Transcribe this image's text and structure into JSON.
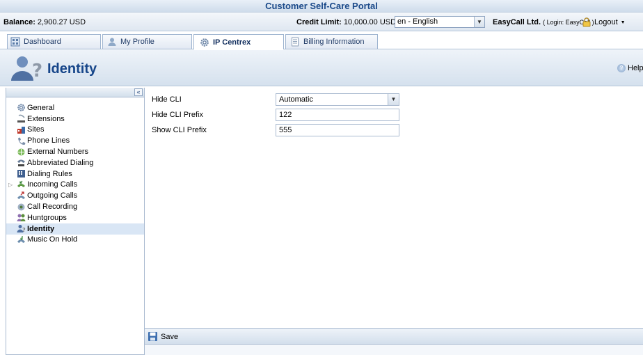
{
  "portal": {
    "title": "Customer Self-Care Portal"
  },
  "info": {
    "balance_label": "Balance:",
    "balance_value": "2,900.27 USD",
    "credit_label": "Credit Limit:",
    "credit_value": "10,000.00 USD",
    "language": "en - English",
    "company_name": "EasyCall Ltd.",
    "login_text": "( Login: EasyCall )",
    "logout_label": "Logout"
  },
  "tabs": [
    {
      "label": "Dashboard",
      "icon": "dashboard-icon"
    },
    {
      "label": "My Profile",
      "icon": "user-icon"
    },
    {
      "label": "IP Centrex",
      "icon": "gear-icon",
      "active": true
    },
    {
      "label": "Billing Information",
      "icon": "document-icon"
    }
  ],
  "header": {
    "title": "Identity",
    "help_label": "Help"
  },
  "sidebar": {
    "items": [
      {
        "label": "General",
        "icon": "gear-icon"
      },
      {
        "label": "Extensions",
        "icon": "extensions-icon"
      },
      {
        "label": "Sites",
        "icon": "sites-icon"
      },
      {
        "label": "Phone Lines",
        "icon": "phone-lines-icon"
      },
      {
        "label": "External Numbers",
        "icon": "external-numbers-icon"
      },
      {
        "label": "Abbreviated Dialing",
        "icon": "abbreviated-dialing-icon"
      },
      {
        "label": "Dialing Rules",
        "icon": "dialing-rules-icon"
      },
      {
        "label": "Incoming Calls",
        "icon": "incoming-calls-icon",
        "expandable": true
      },
      {
        "label": "Outgoing Calls",
        "icon": "outgoing-calls-icon"
      },
      {
        "label": "Call Recording",
        "icon": "call-recording-icon"
      },
      {
        "label": "Huntgroups",
        "icon": "huntgroups-icon"
      },
      {
        "label": "Identity",
        "icon": "identity-icon",
        "active": true
      },
      {
        "label": "Music On Hold",
        "icon": "music-on-hold-icon"
      }
    ]
  },
  "form": {
    "hide_cli": {
      "label": "Hide CLI",
      "value": "Automatic"
    },
    "hide_cli_prefix": {
      "label": "Hide CLI Prefix",
      "value": "122"
    },
    "show_cli_prefix": {
      "label": "Show CLI Prefix",
      "value": "555"
    }
  },
  "toolbar": {
    "save_label": "Save"
  },
  "colors": {
    "accent": "#17468a",
    "active_row": "#d9e6f5",
    "border": "#a9bad0"
  }
}
